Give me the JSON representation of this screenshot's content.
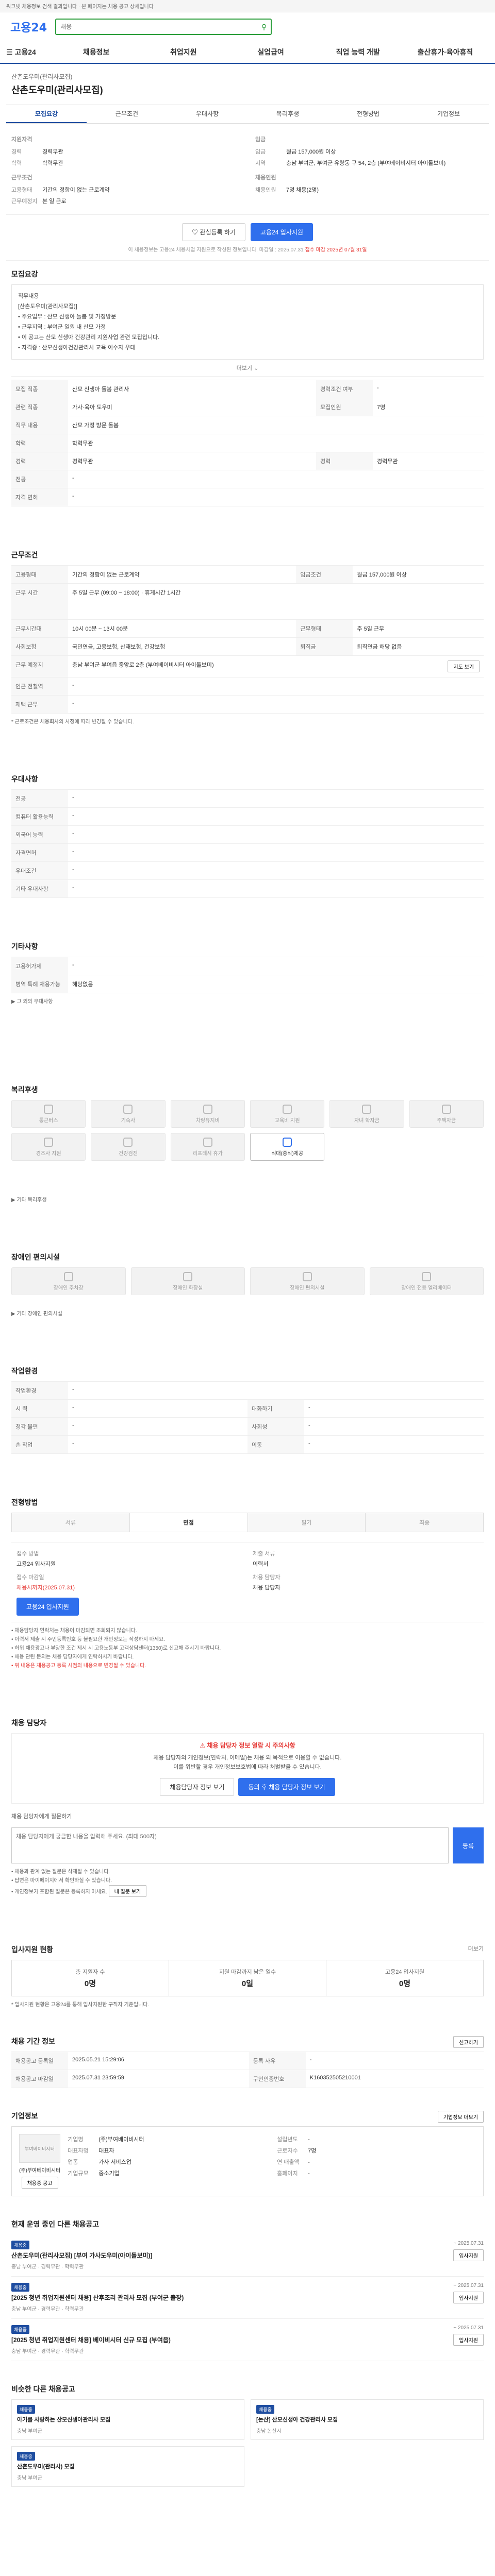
{
  "topbar": {
    "notice": "워크넷 채용정보 검색 결과입니다 · 본 페이지는 채용 공고 상세입니다"
  },
  "header": {
    "logo": "고용24",
    "search_placeholder": "채용"
  },
  "gnb": [
    "고용24",
    "채용정보",
    "취업지원",
    "실업급여",
    "직업 능력 개발",
    "출산휴가·육아휴직"
  ],
  "job": {
    "company": "산촌도우미(관리사모집)",
    "title": "산촌도우미(관리사모집)",
    "tabs": [
      "모집요강",
      "근무조건",
      "우대사항",
      "복리후생",
      "전형방법",
      "기업정보"
    ],
    "summary_left": {
      "group1": "지원자격",
      "rows1": [
        [
          "경력",
          "경력무관"
        ],
        [
          "학력",
          "학력무관"
        ]
      ],
      "group2": "근무조건",
      "rows2": [
        [
          "고용형태",
          "기간의 정함이 없는 근로계약"
        ],
        [
          "근무예정지",
          "본 일 근로"
        ]
      ]
    },
    "summary_right": {
      "group1": "임금",
      "rows1": [
        [
          "임금",
          "월급 157,000원 이상"
        ],
        [
          "지역",
          "충남 부여군, 부여군 유량동 구 54, 2층 (부여베이비시터 아이돌보미)"
        ]
      ],
      "group2": "채용인원",
      "rows2": [
        [
          "채용인원",
          "7명 채용(2명)"
        ]
      ]
    },
    "btn_scrap": "관심등록 하기",
    "btn_apply": "고용24 입사지원",
    "deadline_notice": "이 채용정보는 고용24 채용사업 지원으로 작성된 정보입니다. 마감일 : 2025.07.31",
    "deadline_red": "접수 마감 2025년 07월 31일"
  },
  "recruit": {
    "heading": "모집요강",
    "summary_lines": [
      "직무내용",
      "[산촌도우미(관리사모집)]",
      "• 주요업무 : 산모 신생아 돌봄 및 가정방문",
      "• 근무지역 : 부여군 일원 내 산모 가정",
      "• 이 공고는 산모 신생아 건강관리 지원사업 관련 모집입니다.",
      "• 자격증 : 산모신생아건강관리사 교육 이수자 우대"
    ],
    "more": "더보기",
    "rows": [
      [
        "모집 직종",
        "산모 신생아 돌봄 관리사",
        "경력조건 여부",
        "-"
      ],
      [
        "관련 직종",
        "가사·육아 도우미",
        "모집인원",
        "7명"
      ],
      [
        "직무 내용",
        "산모 가정 방문 돌봄",
        "-",
        "-"
      ],
      [
        "학력",
        "학력무관",
        "-",
        "-"
      ],
      [
        "경력",
        "경력무관",
        "경력",
        "경력무관"
      ],
      [
        "전공",
        "-",
        "-",
        "-"
      ],
      [
        "자격 면허",
        "-",
        "-",
        "-"
      ]
    ]
  },
  "conditions": {
    "heading": "근무조건",
    "rows": [
      [
        "고용형태",
        "기간의 정함이 없는 근로계약",
        "임금조건",
        "월급 157,000원 이상"
      ],
      [
        "근무 시간",
        "주 5일 근무 (09:00 ~ 18:00) · 휴게시간 1시간",
        "",
        ""
      ],
      [
        "근무시간대",
        "10시 00분 ~ 13시 00분",
        "근무형태",
        "주 5일 근무"
      ],
      [
        "사회보험",
        "국민연금, 고용보험, 산재보험, 건강보험",
        "퇴직금",
        "퇴직연금 해당 없음"
      ],
      [
        "근무 예정지",
        "충남 부여군 부여읍 중앙로 2층 (부여베이비시터 아이돌보미)",
        "",
        ""
      ],
      [
        "인근 전철역",
        "-",
        "",
        ""
      ],
      [
        "재택 근무",
        "-",
        "",
        ""
      ]
    ],
    "map_btn": "지도 보기",
    "note": "* 근로조건은 채용회사의 사정에 따라 변경될 수 있습니다."
  },
  "preferred": {
    "heading": "우대사항",
    "rows": [
      [
        "전공",
        "-"
      ],
      [
        "컴퓨터 활용능력",
        "-"
      ],
      [
        "외국어 능력",
        "-"
      ],
      [
        "자격면허",
        "-"
      ],
      [
        "우대조건",
        "-"
      ],
      [
        "기타 우대사항",
        "-"
      ]
    ]
  },
  "misc": {
    "heading": "기타사항",
    "rows": [
      [
        "고용허가제",
        "-"
      ],
      [
        "병역 특례 채용가능",
        "해당없음"
      ]
    ],
    "extra": "그 외의 우대사항"
  },
  "welfare": {
    "heading": "복리후생",
    "chips": [
      "통근버스",
      "기숙사",
      "차량유지비",
      "교육비 지원",
      "자녀 학자금",
      "주택자금",
      "경조사 지원",
      "건강검진",
      "리프레시 휴가",
      "식대(중식)제공"
    ],
    "chip_on": [
      false,
      false,
      false,
      false,
      false,
      false,
      false,
      false,
      false,
      true
    ],
    "extra": "기타 복리후생"
  },
  "disability": {
    "heading": "장애인 편의시설",
    "chips": [
      "장애인 주차장",
      "장애인 화장실",
      "장애인 편의시설",
      "장애인 전용 엘리베이터"
    ],
    "note": "기타 장애인 편의시설"
  },
  "workenv": {
    "heading": "작업환경",
    "rows": [
      [
        "작업환경",
        "-",
        "",
        ""
      ],
      [
        "시 력",
        "-",
        "대화하기",
        "-"
      ],
      [
        "청각 불편",
        "-",
        "사회성",
        "-"
      ],
      [
        "손 작업",
        "-",
        "이동",
        "-"
      ]
    ]
  },
  "screening": {
    "heading": "전형방법",
    "steps": [
      "서류",
      "면접",
      "필기",
      "최종"
    ],
    "step_on": [
      false,
      true,
      false,
      false
    ],
    "apply_method": "접수 방법",
    "apply_method_value": "고용24 입사지원",
    "deadline_label": "접수 마감일",
    "deadline_value": "채용시까지(2025.07.31)",
    "submit_docs_label": "제출 서류",
    "submit_docs_value": "이력서",
    "contact_label": "채용 담당자",
    "contact_value": "채용 담당자",
    "apply_btn": "고용24 입사지원",
    "bullets": [
      "• 채용담당자 연락처는 채용이 마감되면 조회되지 않습니다.",
      "• 이력서 제출 시 주민등록번호 등 불필요한 개인정보는 작성하지 마세요.",
      "• 허위 채용광고나 부당한 조건 제시 시 고용노동부 고객상담센터(1350)로 신고해 주시기 바랍니다.",
      "• 채용 관련 문의는 채용 담당자에게 연락하시기 바랍니다."
    ],
    "bullet_red": "• 위 내용은 채용공고 등록 시점의 내용으로 변경될 수 있습니다."
  },
  "contact": {
    "heading": "채용 담당자",
    "warn_title": "채용 담당자 정보 열람 시 주의사항",
    "warn_lines": [
      "채용 담당자의 개인정보(연락처, 이메일)는 채용 외 목적으로 이용할 수 없습니다.",
      "이를 위반할 경우 개인정보보호법에 따라 처벌받을 수 있습니다."
    ],
    "btn_view": "채용담당자 정보 보기",
    "btn_agree": "동의 후 채용 담당자 정보 보기"
  },
  "qa": {
    "heading": "채용 담당자에게 질문하기",
    "placeholder": "채용 담당자에게 궁금한 내용을 입력해 주세요. (최대 500자)",
    "submit": "등록",
    "bullets": [
      "• 채용과 관계 없는 질문은 삭제될 수 있습니다.",
      "• 답변은 마이페이지에서 확인하실 수 있습니다.",
      "• 개인정보가 포함된 질문은 등록하지 마세요."
    ],
    "my_btn": "내 질문 보기"
  },
  "stats": {
    "heading": "입사지원 현황",
    "more": "더보기",
    "items": [
      [
        "총 지원자 수",
        "0명"
      ],
      [
        "지원 마감까지 남은 일수",
        "0일"
      ],
      [
        "고용24 입사지원",
        "0명"
      ]
    ],
    "note": "* 입사지원 현황은 고용24를 통해 입사지원한 구직자 기준입니다."
  },
  "jobinfo": {
    "heading": "채용 기간 정보",
    "rows": [
      [
        "채용공고 등록일",
        "2025.05.21 15:29:06",
        "등록 사유",
        "-"
      ],
      [
        "채용공고 마감일",
        "2025.07.31 23:59:59",
        "구인인증번호",
        "K160352505210001"
      ]
    ],
    "report_btn": "신고하기"
  },
  "company_info": {
    "heading": "기업정보",
    "logo_text": "부여베이비시터",
    "name": "(주)부여베이비시터",
    "rows": [
      [
        "기업명",
        "(주)부여베이비시터"
      ],
      [
        "대표자명",
        "대표자"
      ],
      [
        "업종",
        "가사 서비스업"
      ],
      [
        "기업규모",
        "중소기업"
      ]
    ],
    "rows_right": [
      [
        "설립년도",
        "-"
      ],
      [
        "근로자수",
        "7명"
      ],
      [
        "연 매출액",
        "-"
      ],
      [
        "홈페이지",
        "-"
      ]
    ],
    "btn_more": "기업정보 더보기",
    "btn_jobs": "채용중 공고"
  },
  "other_jobs": {
    "heading": "현재 운영 중인 다른 채용공고",
    "items": [
      {
        "badge": "채용중",
        "title": "산촌도우미(관리사모집) [부여 가사도우미(아이돌보미)]",
        "meta": "충남 부여군 · 경력무관 · 학력무관",
        "date": "~ 2025.07.31",
        "btn": "입사지원"
      },
      {
        "badge": "채용중",
        "title": "[2025 청년 취업지원센터 채용] 산후조리 관리사 모집 (부여군 출장)",
        "meta": "충남 부여군 · 경력무관 · 학력무관",
        "date": "~ 2025.07.31",
        "btn": "입사지원"
      },
      {
        "badge": "채용중",
        "title": "[2025 청년 취업지원센터 채용] 베이비시터 신규 모집 (부여읍)",
        "meta": "충남 부여군 · 경력무관 · 학력무관",
        "date": "~ 2025.07.31",
        "btn": "입사지원"
      }
    ]
  },
  "similar": {
    "heading": "비슷한 다른 채용공고",
    "items": [
      {
        "badge": "채용중",
        "title": "아기를 사랑하는 산모신생아관리사 모집",
        "meta": "충남 부여군"
      },
      {
        "badge": "채용중",
        "title": "[논산] 산모신생아 건강관리사 모집",
        "meta": "충남 논산시"
      },
      {
        "badge": "채용중",
        "title": "산촌도우미(관리사) 모집",
        "meta": "충남 부여군"
      }
    ]
  }
}
